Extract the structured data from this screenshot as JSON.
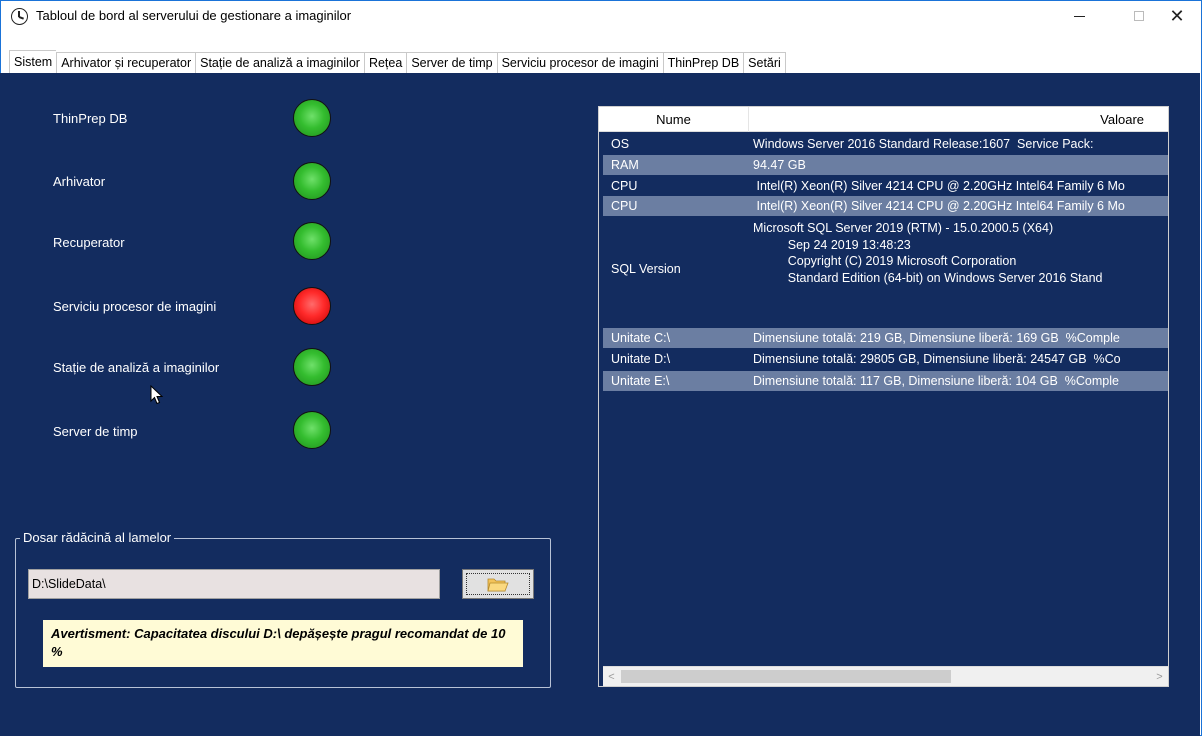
{
  "window": {
    "title": "Tabloul de bord al serverului de gestionare a imaginilor",
    "close_glyph": "✕"
  },
  "tabs": [
    {
      "label": "Sistem",
      "active": true
    },
    {
      "label": "Arhivator și recuperator",
      "active": false
    },
    {
      "label": "Stație de analiză a imaginilor",
      "active": false
    },
    {
      "label": "Rețea",
      "active": false
    },
    {
      "label": "Server de timp",
      "active": false
    },
    {
      "label": "Serviciu procesor de imagini",
      "active": false
    },
    {
      "label": "ThinPrep DB",
      "active": false
    },
    {
      "label": "Setări",
      "active": false
    }
  ],
  "status": {
    "items": [
      {
        "label": "ThinPrep DB",
        "state": "green"
      },
      {
        "label": "Arhivator",
        "state": "green"
      },
      {
        "label": "Recuperator",
        "state": "green"
      },
      {
        "label": "Serviciu procesor de imagini",
        "state": "red"
      },
      {
        "label": "Stație de analiză a imaginilor",
        "state": "green"
      },
      {
        "label": "Server de timp",
        "state": "green"
      }
    ],
    "colors": {
      "green": "#34bd2f",
      "red": "#ff2a2a"
    }
  },
  "root_folder": {
    "group_title": "Dosar rădăcină al lamelor",
    "path_value": "D:\\SlideData\\",
    "warning": "Avertisment: Capacitatea discului D:\\ depășește pragul recomandat de 10 %"
  },
  "sysinfo": {
    "col_name": "Nume",
    "col_value": "Valoare",
    "rows": [
      {
        "name": "OS",
        "value": "Windows Server 2016 Standard Release:1607  Service Pack:"
      },
      {
        "name": "RAM",
        "value": "94.47 GB"
      },
      {
        "name": "CPU",
        "value": " Intel(R) Xeon(R) Silver 4214 CPU @ 2.20GHz Intel64 Family 6 Mo"
      },
      {
        "name": "CPU",
        "value": " Intel(R) Xeon(R) Silver 4214 CPU @ 2.20GHz Intel64 Family 6 Mo"
      },
      {
        "name": "SQL Version",
        "value": "Microsoft SQL Server 2019 (RTM) - 15.0.2000.5 (X64)\n          Sep 24 2019 13:48:23\n          Copyright (C) 2019 Microsoft Corporation\n          Standard Edition (64-bit) on Windows Server 2016 Stand"
      },
      {
        "name": "Unitate C:\\",
        "value": "Dimensiune totală: 219 GB, Dimensiune liberă: 169 GB  %Comple"
      },
      {
        "name": "Unitate D:\\",
        "value": "Dimensiune totală: 29805 GB, Dimensiune liberă: 24547 GB  %Co"
      },
      {
        "name": "Unitate E:\\",
        "value": "Dimensiune totală: 117 GB, Dimensiune liberă: 104 GB  %Comple"
      }
    ],
    "scroll_left": "<",
    "scroll_right": ">"
  },
  "theme": {
    "panel_bg": "#132c5f",
    "row_alt_bg": "#6b7ea2",
    "warning_bg": "#fffbd6"
  }
}
